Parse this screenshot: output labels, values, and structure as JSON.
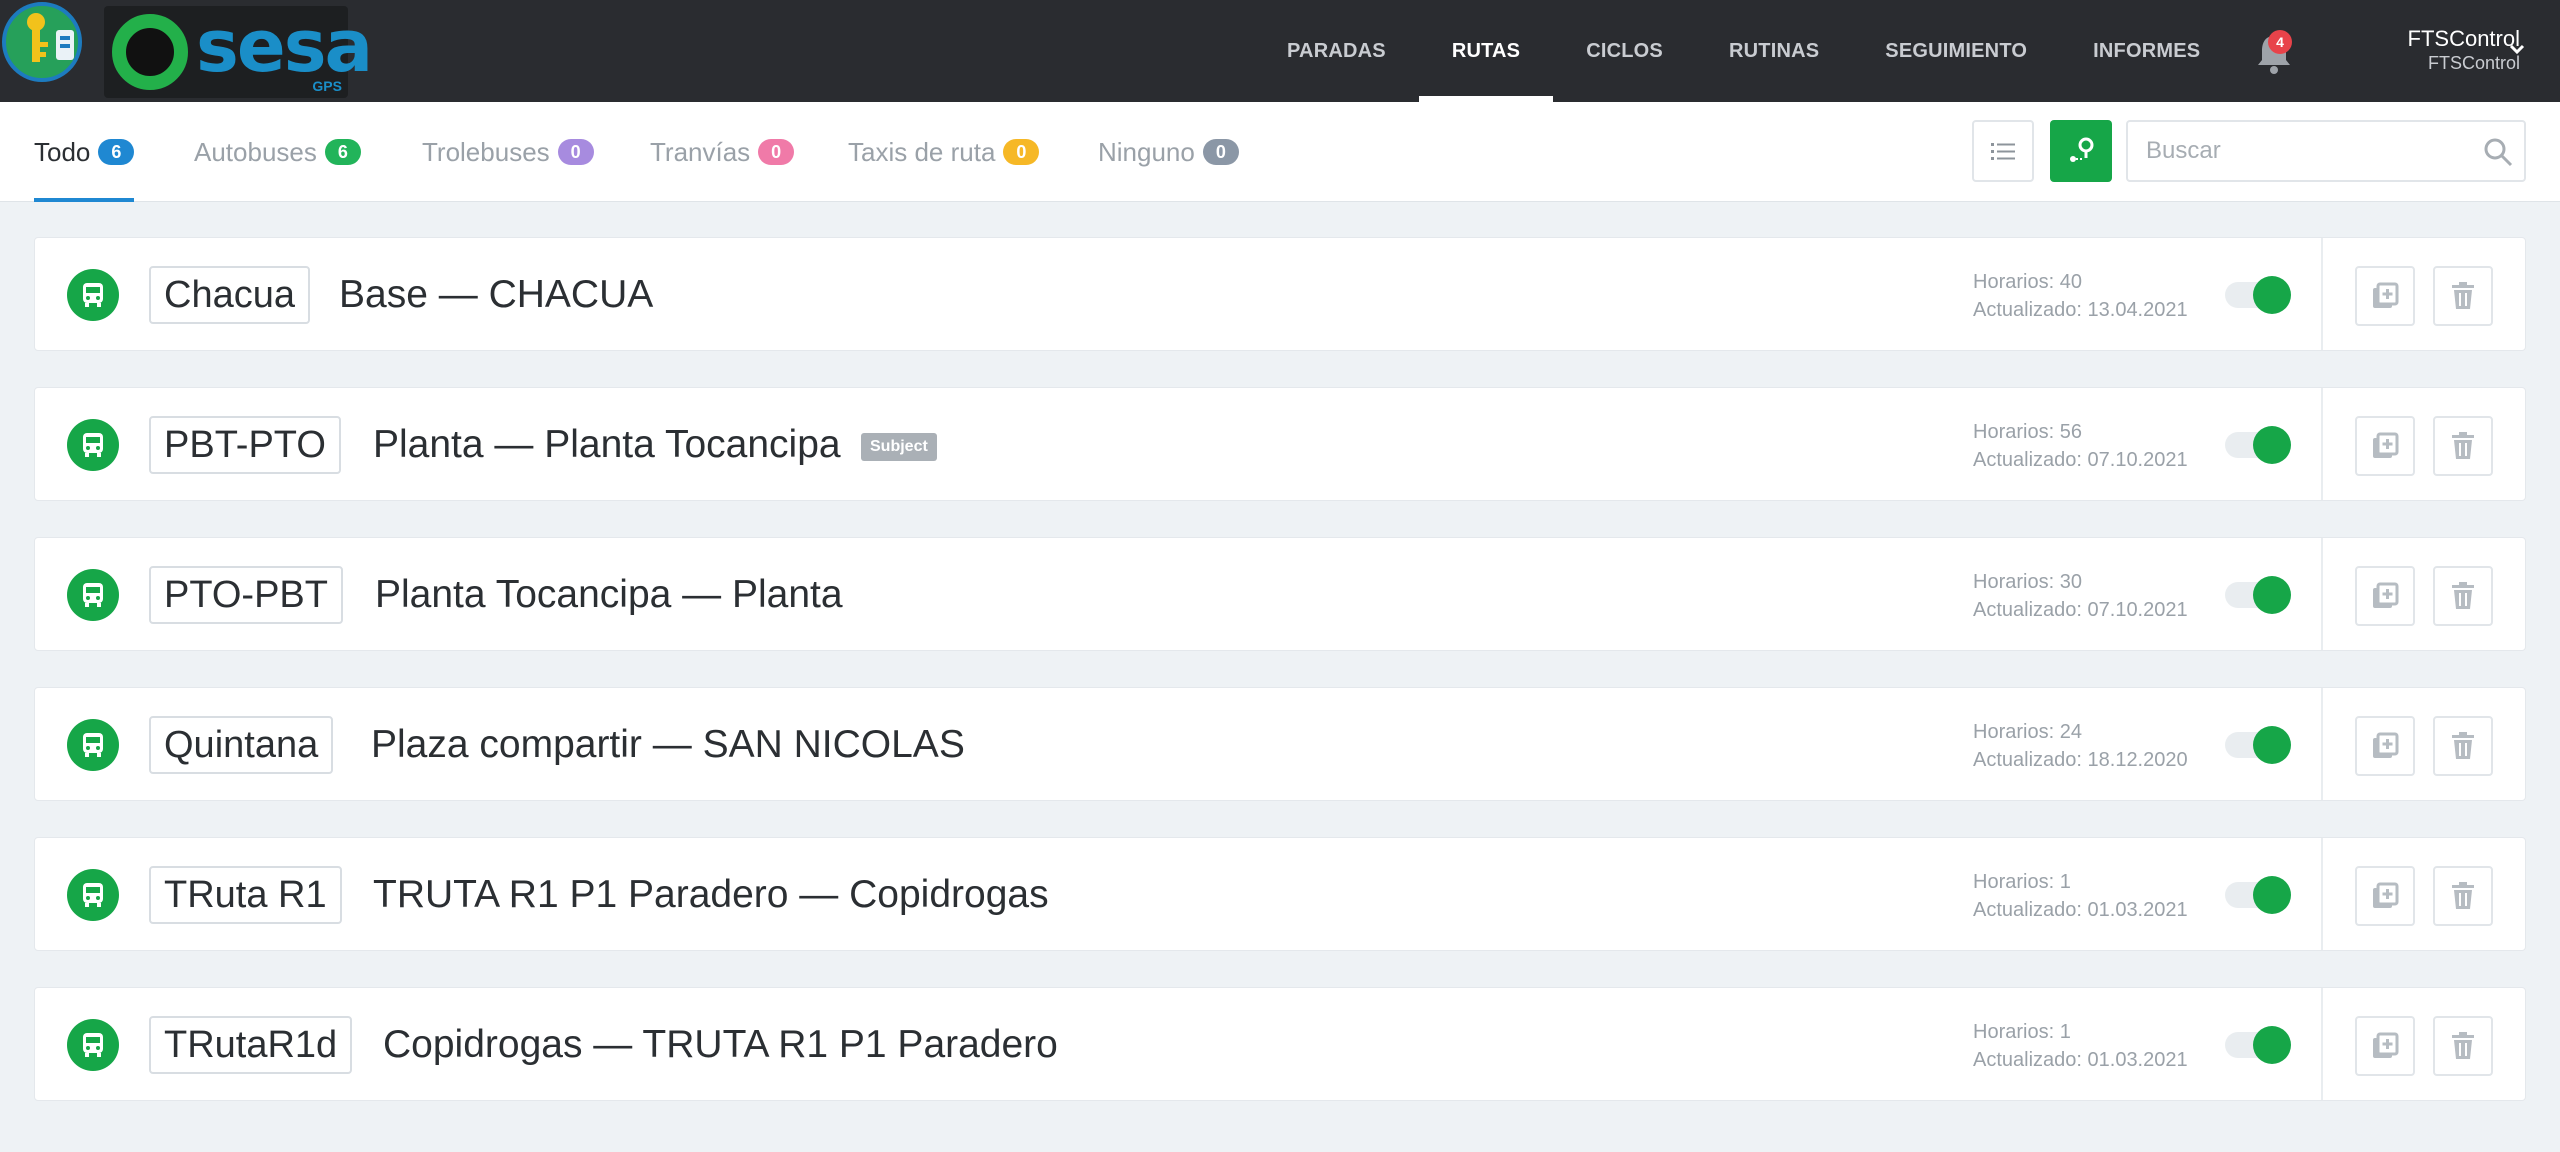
{
  "brand": {
    "word": "sesa",
    "sub": "GPS",
    "colors": {
      "green": "#23b04a",
      "blue": "#1a8ec8"
    }
  },
  "nav": {
    "items": [
      {
        "label": "PARADAS",
        "active": false
      },
      {
        "label": "RUTAS",
        "active": true
      },
      {
        "label": "CICLOS",
        "active": false
      },
      {
        "label": "RUTINAS",
        "active": false
      },
      {
        "label": "SEGUIMIENTO",
        "active": false
      },
      {
        "label": "INFORMES",
        "active": false
      }
    ],
    "notifications": "4",
    "user": {
      "name": "FTSControl",
      "account": "FTSControl"
    }
  },
  "filters": {
    "tabs": [
      {
        "label": "Todo",
        "count": "6",
        "color": "#1f88d2",
        "active": true
      },
      {
        "label": "Autobuses",
        "count": "6",
        "color": "#22b45a",
        "active": false
      },
      {
        "label": "Trolebuses",
        "count": "0",
        "color": "#a78bdf",
        "active": false
      },
      {
        "label": "Tranvías",
        "count": "0",
        "color": "#f07aa8",
        "active": false
      },
      {
        "label": "Taxis de ruta",
        "count": "0",
        "color": "#f6b826",
        "active": false
      },
      {
        "label": "Ninguno",
        "count": "0",
        "color": "#8b97a6",
        "active": false
      }
    ],
    "search_placeholder": "Buscar"
  },
  "routes": [
    {
      "code": "Chacua",
      "name": "Base — CHACUA",
      "tag": "",
      "horarios": "Horarios: 40",
      "updated": "Actualizado: 13.04.2021",
      "enabled": true
    },
    {
      "code": "PBT-PTO",
      "name": "Planta — Planta Tocancipa",
      "tag": "Subject",
      "horarios": "Horarios: 56",
      "updated": "Actualizado: 07.10.2021",
      "enabled": true
    },
    {
      "code": "PTO-PBT",
      "name": "Planta Tocancipa — Planta",
      "tag": "",
      "horarios": "Horarios: 30",
      "updated": "Actualizado: 07.10.2021",
      "enabled": true
    },
    {
      "code": "Quintana",
      "name": "Plaza compartir — SAN NICOLAS",
      "tag": "",
      "horarios": "Horarios: 24",
      "updated": "Actualizado: 18.12.2020",
      "enabled": true
    },
    {
      "code": "TRuta R1",
      "name": "TRUTA R1 P1 Paradero — Copidrogas",
      "tag": "",
      "horarios": "Horarios: 1",
      "updated": "Actualizado: 01.03.2021",
      "enabled": true
    },
    {
      "code": "TRutaR1d",
      "name": "Copidrogas — TRUTA R1 P1 Paradero",
      "tag": "",
      "horarios": "Horarios: 1",
      "updated": "Actualizado: 01.03.2021",
      "enabled": true
    }
  ],
  "icons": {
    "route_type": "bus-icon",
    "list_view": "list-icon",
    "map_route": "route-pin-icon",
    "copy": "copy-add-icon",
    "delete": "trash-icon"
  }
}
